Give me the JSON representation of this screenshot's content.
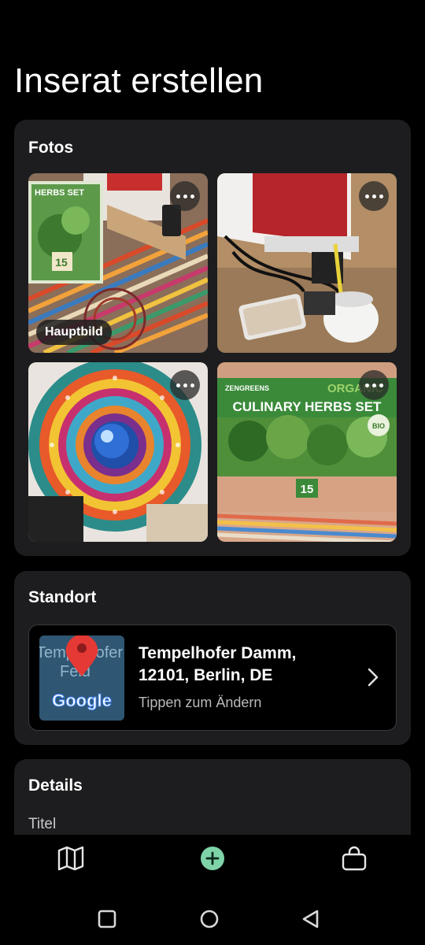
{
  "page": {
    "title": "Inserat erstellen"
  },
  "photos": {
    "title": "Fotos",
    "main_badge": "Hauptbild",
    "items": [
      {
        "name": "photo-1",
        "main": true
      },
      {
        "name": "photo-2",
        "main": false
      },
      {
        "name": "photo-3",
        "main": false
      },
      {
        "name": "photo-4",
        "main": false
      }
    ],
    "photo4_text": {
      "brand": "ZENGREENS",
      "badge": "ORGANIC",
      "headline": "CULINARY HERBS SET",
      "count": "15",
      "bio": "BIO"
    },
    "photo1_text": {
      "headline": "HERBS SET",
      "count": "15"
    }
  },
  "location": {
    "title": "Standort",
    "address_line1": "Tempelhofer Damm,",
    "address_line2": "12101, Berlin, DE",
    "hint": "Tippen zum Ändern",
    "map_text_1": "Tempelhofer",
    "map_text_2": "Feld",
    "map_brand": "Google"
  },
  "details": {
    "title": "Details",
    "title_field_label": "Titel"
  },
  "colors": {
    "accent": "#7fd3a8",
    "background": "#000000",
    "card": "#1d1d1f",
    "pin": "#e53935"
  },
  "icons": {
    "nav": [
      "map-icon",
      "add-circle-icon",
      "bag-icon"
    ],
    "system": [
      "recents-square-icon",
      "home-circle-icon",
      "back-triangle-icon"
    ]
  }
}
